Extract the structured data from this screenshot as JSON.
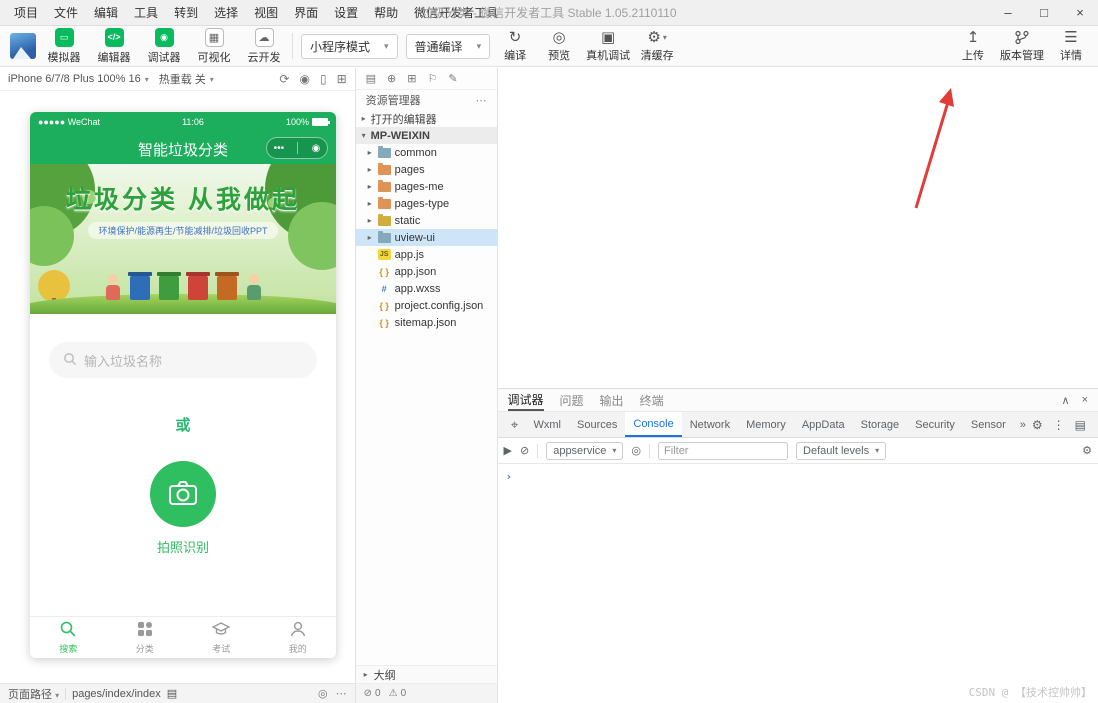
{
  "icons": {
    "caret_down": "▾",
    "caret_right": "▸",
    "more_h": "⋯",
    "more_v": "⋮",
    "simulator": "▭",
    "editor": "</>",
    "debugger": "◉",
    "visual": "▦",
    "cloud": "☁",
    "compile": "↻",
    "preview": "◎",
    "real_device": "▣",
    "clear_cache": "⚙",
    "upload": "↥",
    "details": "☰",
    "rotate": "⟳",
    "screenshot": "◉",
    "device_frame": "▯",
    "layout_grid": "⊞",
    "exp_copy": "▤",
    "exp_add": "⊕",
    "exp_grid": "⊞",
    "exp_flag": "⚐",
    "exp_pen": "✎",
    "collapse": "∧",
    "close": "×",
    "minimize": "–",
    "maximize": "□",
    "gear": "⚙",
    "eye": "◎",
    "inspect": "⌖",
    "clear": "⊘",
    "panel": "▶",
    "warn": "⚠",
    "error": "⊘",
    "copy": "▤",
    "capsule_more": "•••",
    "capsule_home": "◉",
    "signal_dots": "●●●●●"
  },
  "titlebar": {
    "menus": [
      "项目",
      "文件",
      "编辑",
      "工具",
      "转到",
      "选择",
      "视图",
      "界面",
      "设置",
      "帮助",
      "微信开发者工具"
    ],
    "title": "垃圾分类 - 微信开发者工具 Stable 1.05.2110110"
  },
  "toolbar": {
    "buttons": [
      {
        "label": "模拟器"
      },
      {
        "label": "编辑器"
      },
      {
        "label": "调试器"
      },
      {
        "label": "可视化"
      },
      {
        "label": "云开发"
      }
    ],
    "mode_select": "小程序模式",
    "compile_select": "普通编译",
    "actions": [
      {
        "label": "编译"
      },
      {
        "label": "预览"
      },
      {
        "label": "真机调试"
      },
      {
        "label": "清缓存"
      }
    ],
    "right_actions": [
      {
        "label": "上传"
      },
      {
        "label": "版本管理"
      },
      {
        "label": "详情"
      }
    ]
  },
  "simulator": {
    "device": "iPhone 6/7/8 Plus 100% 16",
    "hot_reload": "热重载 关",
    "footer_label": "页面路径",
    "page_path": "pages/index/index"
  },
  "phone": {
    "status_carrier": "WeChat",
    "status_time": "11:06",
    "status_battery": "100%",
    "nav_title": "智能垃圾分类",
    "banner": {
      "title": "垃圾分类 从我做起",
      "subtitle": "环境保护/能源再生/节能减排/垃圾回收PPT"
    },
    "search_placeholder": "输入垃圾名称",
    "or_text": "或",
    "camera_label": "拍照识别",
    "tabs": [
      {
        "label": "搜索",
        "active": true
      },
      {
        "label": "分类",
        "active": false
      },
      {
        "label": "考试",
        "active": false
      },
      {
        "label": "我的",
        "active": false
      }
    ]
  },
  "explorer": {
    "header": "资源管理器",
    "open_editors": "打开的编辑器",
    "root": "MP-WEIXIN",
    "tree": [
      {
        "name": "common"
      },
      {
        "name": "pages"
      },
      {
        "name": "pages-me"
      },
      {
        "name": "pages-type"
      },
      {
        "name": "static"
      },
      {
        "name": "uview-ui"
      },
      {
        "name": "app.js"
      },
      {
        "name": "app.json"
      },
      {
        "name": "app.wxss"
      },
      {
        "name": "project.config.json"
      },
      {
        "name": "sitemap.json"
      }
    ],
    "outline": "大纲",
    "errors": "0",
    "warnings": "0",
    "js_badge": "JS",
    "braces": "{ }",
    "hash": "#"
  },
  "debugger": {
    "tabs": [
      {
        "label": "调试器",
        "active": true
      },
      {
        "label": "问题",
        "active": false
      },
      {
        "label": "输出",
        "active": false
      },
      {
        "label": "终端",
        "active": false
      }
    ],
    "devtools_tabs": [
      {
        "label": "Wxml",
        "active": false
      },
      {
        "label": "Sources",
        "active": false
      },
      {
        "label": "Console",
        "active": true
      },
      {
        "label": "Network",
        "active": false
      },
      {
        "label": "Memory",
        "active": false
      },
      {
        "label": "AppData",
        "active": false
      },
      {
        "label": "Storage",
        "active": false
      },
      {
        "label": "Security",
        "active": false
      },
      {
        "label": "Sensor",
        "active": false
      }
    ],
    "devtools_overflow": "»",
    "console": {
      "context": "appservice",
      "filter_placeholder": "Filter",
      "levels": "Default levels",
      "prompt": "›"
    }
  },
  "watermark": "CSDN @ 【技术控帅帅】"
}
